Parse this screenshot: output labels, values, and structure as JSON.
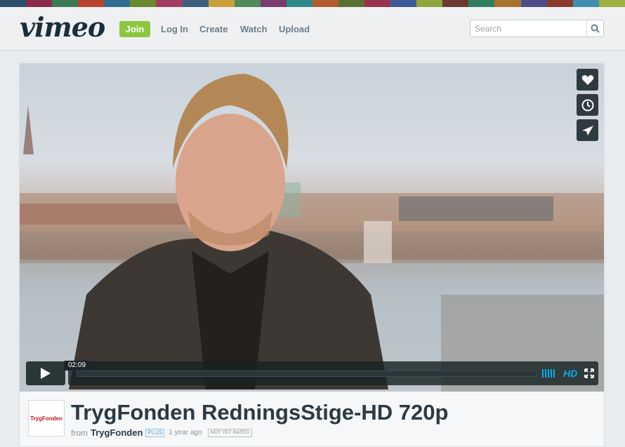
{
  "header": {
    "logo": "vimeo",
    "join_label": "Join",
    "nav": [
      "Log In",
      "Create",
      "Watch",
      "Upload"
    ],
    "search_placeholder": "Search",
    "stripe_colors": [
      "#2b4f6b",
      "#8a2b4a",
      "#3a7a53",
      "#b8432b",
      "#2f6e8f",
      "#6a8a2c",
      "#a33c62",
      "#3c5f7d",
      "#c9a03a",
      "#4f8a57",
      "#7a3b6f",
      "#2e8a8a",
      "#b25c2f",
      "#5b6f2e",
      "#9a2f4f",
      "#3a5a9a",
      "#8fa53a",
      "#6b3a2f",
      "#2f7f5f",
      "#a8732f",
      "#4c4c8a",
      "#8a3a2b",
      "#3f8fb0",
      "#9fb040"
    ]
  },
  "video": {
    "timestamp": "02:09",
    "hd_label": "HD",
    "side_buttons": [
      "heart-icon",
      "clock-icon",
      "send-icon"
    ]
  },
  "clip": {
    "title": "TrygFonden RedningsStige-HD 720p",
    "from_label": "from",
    "owner": "TrygFonden",
    "owner_logo_text": "TrygFonden",
    "plus_badge": "PLUS",
    "age": "1 year ago",
    "rating": "NOT YET RATED"
  }
}
